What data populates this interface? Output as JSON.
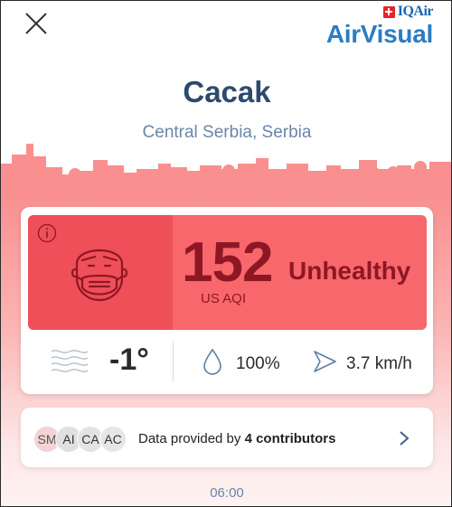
{
  "brand": {
    "iqair": "IQAir",
    "airvisual": "AirVisual"
  },
  "location": {
    "city": "Cacak",
    "region": "Central Serbia, Serbia"
  },
  "aqi": {
    "value": "152",
    "unit": "US AQI",
    "status": "Unhealthy"
  },
  "weather": {
    "temperature": "-1°",
    "humidity": "100%",
    "wind_speed": "3.7 km/h"
  },
  "contributors": {
    "avatars": [
      "SM",
      "AI",
      "CA",
      "AC"
    ],
    "text_prefix": "Data provided by ",
    "text_bold": "4 contributors"
  },
  "time": "06:00",
  "colors": {
    "aqi_panel": "#f7676b",
    "aqi_face": "#ef4f58",
    "aqi_text": "#8e1724",
    "city": "#2c4a6e",
    "brand": "#2a7dc4"
  },
  "icons": [
    "close-icon",
    "info-icon",
    "mask-face-icon",
    "wind-icon",
    "droplet-icon",
    "wind-direction-icon",
    "chevron-right-icon"
  ]
}
